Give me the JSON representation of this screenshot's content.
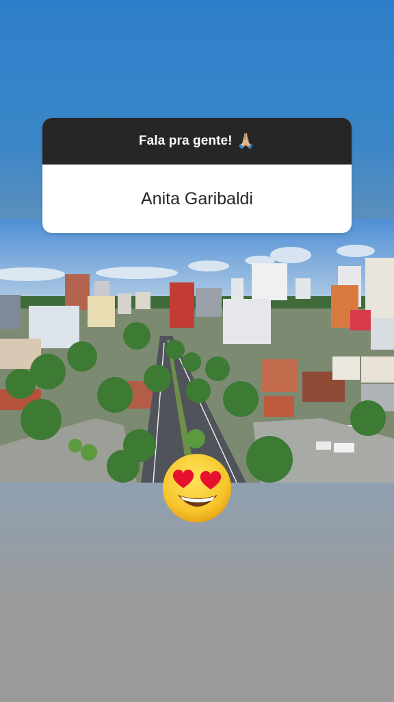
{
  "question_sticker": {
    "prompt": "Fala pra gente!",
    "prompt_emoji": "🙏🏼",
    "answer": "Anita Garibaldi"
  },
  "background": {
    "top_color": "#2e7fca",
    "bottom_color": "#9a9a9a"
  },
  "photo": {
    "subject": "city-aerial-view-photo"
  },
  "sticker_emoji": {
    "icon": "heart-eyes-emoji-icon"
  },
  "colors": {
    "card_header": "#262626",
    "card_body": "#ffffff"
  }
}
